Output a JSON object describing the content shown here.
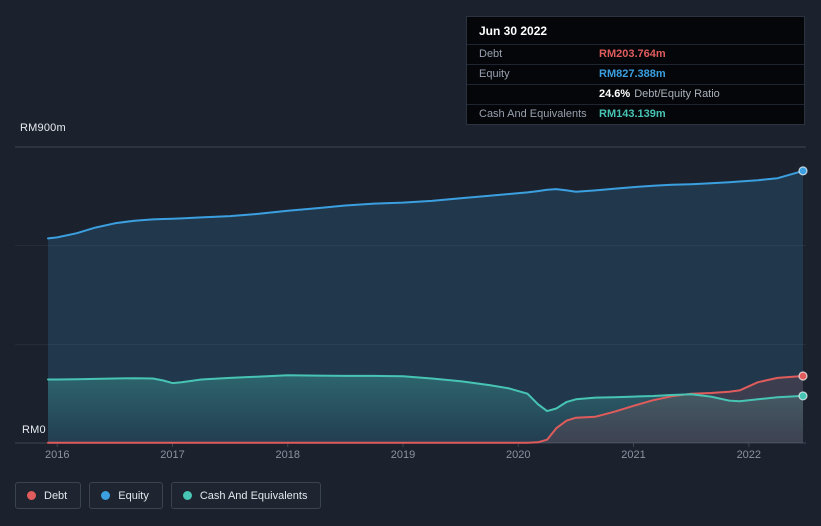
{
  "colors": {
    "debt": "#e05c5c",
    "equity": "#3b9fe0",
    "cash": "#47c4b3",
    "background": "#1b222d"
  },
  "tooltip": {
    "title": "Jun 30 2022",
    "debt_label": "Debt",
    "debt_value": "RM203.764m",
    "equity_label": "Equity",
    "equity_value": "RM827.388m",
    "ratio_value": "24.6%",
    "ratio_label": "Debt/Equity Ratio",
    "cash_label": "Cash And Equivalents",
    "cash_value": "RM143.139m"
  },
  "axis": {
    "y_top_label": "RM900m",
    "y_bottom_label": "RM0"
  },
  "legend": [
    {
      "key": "debt",
      "label": "Debt"
    },
    {
      "key": "equity",
      "label": "Equity"
    },
    {
      "key": "cash",
      "label": "Cash And Equivalents"
    }
  ],
  "chart_data": {
    "type": "area",
    "unit": "RM millions",
    "x": [
      2015.92,
      2016.0,
      2016.17,
      2016.33,
      2016.5,
      2016.67,
      2016.83,
      2016.92,
      2017.0,
      2017.08,
      2017.25,
      2017.5,
      2017.75,
      2018.0,
      2018.25,
      2018.5,
      2018.75,
      2019.0,
      2019.25,
      2019.5,
      2019.75,
      2019.92,
      2020.08,
      2020.17,
      2020.25,
      2020.33,
      2020.42,
      2020.5,
      2020.67,
      2020.83,
      2021.0,
      2021.17,
      2021.33,
      2021.5,
      2021.67,
      2021.83,
      2021.92,
      2022.08,
      2022.25,
      2022.47
    ],
    "series": [
      {
        "key": "equity",
        "name": "Equity",
        "values": [
          622,
          625,
          638,
          655,
          668,
          676,
          680,
          681,
          682,
          683,
          686,
          690,
          697,
          706,
          714,
          722,
          728,
          731,
          736,
          744,
          752,
          757,
          762,
          766,
          770,
          772,
          768,
          764,
          768,
          773,
          778,
          782,
          785,
          787,
          790,
          793,
          795,
          799,
          805,
          827.388
        ]
      },
      {
        "key": "cash",
        "name": "Cash And Equivalents",
        "values": [
          193,
          193,
          194,
          195,
          196,
          197,
          196,
          190,
          182,
          185,
          193,
          198,
          202,
          206,
          205,
          204,
          204,
          203,
          196,
          188,
          176,
          166,
          150,
          118,
          97,
          105,
          125,
          133,
          138,
          139,
          141,
          143,
          146,
          148,
          141,
          129,
          127,
          133,
          139,
          143.139
        ]
      },
      {
        "key": "debt",
        "name": "Debt",
        "values": [
          1,
          1,
          1,
          1,
          1,
          1,
          1,
          1,
          1,
          1,
          1,
          1,
          1,
          1,
          1,
          1,
          1,
          1,
          1,
          1,
          1,
          1,
          1,
          2,
          10,
          45,
          68,
          77,
          80,
          95,
          113,
          130,
          142,
          150,
          152,
          156,
          160,
          185,
          198,
          203.764
        ]
      }
    ],
    "xlim": [
      2015.92,
      2022.47
    ],
    "ylim": [
      0,
      900
    ],
    "y_gridlines": [
      0,
      300,
      600,
      900
    ],
    "x_tick_years": [
      2016,
      2017,
      2018,
      2019,
      2020,
      2021,
      2022
    ],
    "highlight_date": "Jun 30 2022",
    "end_values": {
      "debt": 203.764,
      "equity": 827.388,
      "cash": 143.139,
      "debt_equity_ratio_pct": 24.6
    }
  }
}
